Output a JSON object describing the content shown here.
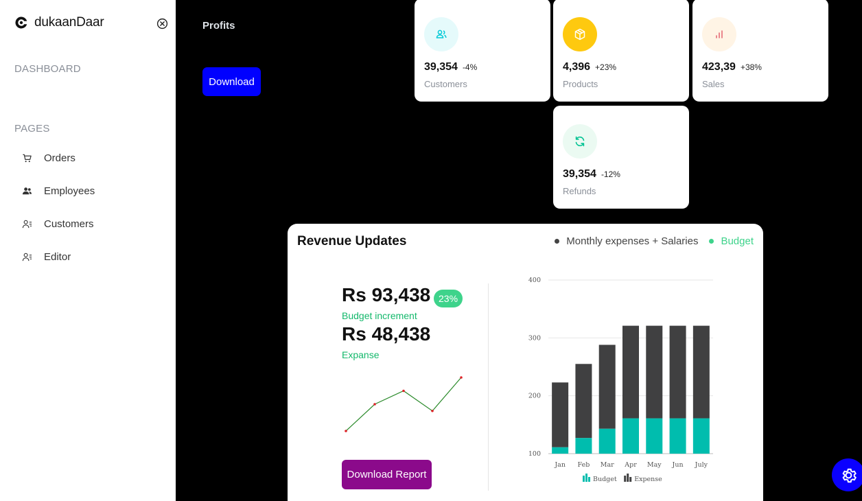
{
  "sidebar": {
    "brand": "dukaanDaar",
    "sections": {
      "dashboard": "DASHBOARD",
      "pages": "PAGES"
    },
    "items": [
      {
        "label": "Orders",
        "icon": "cart-icon"
      },
      {
        "label": "Employees",
        "icon": "users-icon"
      },
      {
        "label": "Customers",
        "icon": "user-list-icon"
      },
      {
        "label": "Editor",
        "icon": "user-list-icon"
      }
    ]
  },
  "header": {
    "title": "Profits",
    "download_label": "Download"
  },
  "stats": [
    {
      "value": "39,354",
      "change": "-4%",
      "label": "Customers",
      "icon": "users-icon",
      "icon_color": "#03c9d7",
      "icon_bg": "#e5fafb"
    },
    {
      "value": "4,396",
      "change": "+23%",
      "label": "Products",
      "icon": "box-icon",
      "icon_color": "#ffffff",
      "icon_bg": "#fec90f"
    },
    {
      "value": "423,39",
      "change": "+38%",
      "label": "Sales",
      "icon": "bar-chart-icon",
      "icon_color": "#e46a76",
      "icon_bg": "#fff4e5"
    },
    {
      "value": "39,354",
      "change": "-12%",
      "label": "Refunds",
      "icon": "refresh-icon",
      "icon_color": "#00c292",
      "icon_bg": "#ebfaf2"
    }
  ],
  "revenue": {
    "title": "Revenue Updates",
    "legend": [
      {
        "label": "Monthly expenses + Salaries",
        "color": "#444444"
      },
      {
        "label": "Budget",
        "color": "#3ed38b"
      }
    ],
    "budget_amount": "Rs 93,438",
    "budget_pct": "23%",
    "budget_label": "Budget increment",
    "expense_amount": "Rs 48,438",
    "expense_label": "Expanse",
    "report_button": "Download Report"
  },
  "sparkline_data": {
    "values": [
      2,
      6,
      8,
      5,
      10
    ],
    "color": "#2a8a2a",
    "point_color": "#e0242b"
  },
  "chart_data": {
    "type": "bar",
    "stacked": true,
    "categories": [
      "Jan",
      "Feb",
      "Mar",
      "Apr",
      "May",
      "Jun",
      "July"
    ],
    "series": [
      {
        "name": "Budget",
        "values": [
          111,
          127,
          143,
          161,
          161,
          161,
          161
        ],
        "color": "#00bdae"
      },
      {
        "name": "Expense",
        "values": [
          223,
          255,
          288,
          321,
          321,
          321,
          321
        ],
        "color": "#404041"
      }
    ],
    "ylim": [
      100,
      400
    ],
    "yticks": [
      100,
      200,
      300,
      400
    ],
    "grid": true,
    "legend": "bottom"
  },
  "colors": {
    "accent": "#0000ff",
    "report": "#8b0a8b",
    "fab": "#0a00ff"
  }
}
